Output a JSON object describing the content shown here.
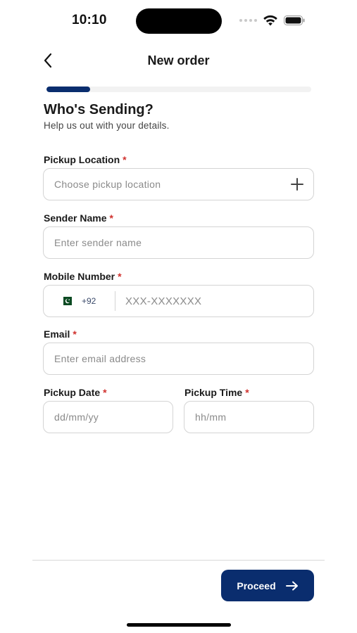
{
  "status_bar": {
    "time": "10:10"
  },
  "header": {
    "title": "New order",
    "back_icon": "chevron-left-icon"
  },
  "progress": {
    "step_fraction": 0.166
  },
  "section": {
    "title": "Who's Sending?",
    "subtitle": "Help us out with your details."
  },
  "form": {
    "required_mark": "*",
    "pickup_location": {
      "label": "Pickup Location",
      "placeholder": "Choose pickup location",
      "value": "",
      "icon": "plus-icon"
    },
    "sender_name": {
      "label": "Sender Name",
      "placeholder": "Enter sender name",
      "value": ""
    },
    "mobile_number": {
      "label": "Mobile Number",
      "country_flag": "pakistan-flag-icon",
      "dial_code": "+92",
      "placeholder": "XXX-XXXXXXX",
      "value": ""
    },
    "email": {
      "label": "Email",
      "placeholder": "Enter email address",
      "value": ""
    },
    "pickup_date": {
      "label": "Pickup Date",
      "placeholder": "dd/mm/yy",
      "value": ""
    },
    "pickup_time": {
      "label": "Pickup Time",
      "placeholder": "hh/mm",
      "value": ""
    }
  },
  "footer": {
    "proceed_label": "Proceed",
    "proceed_icon": "arrow-right-icon"
  },
  "colors": {
    "primary": "#0a2d6e",
    "required": "#d0312d",
    "border": "#d4d4d4",
    "placeholder": "#8a8a8a"
  }
}
